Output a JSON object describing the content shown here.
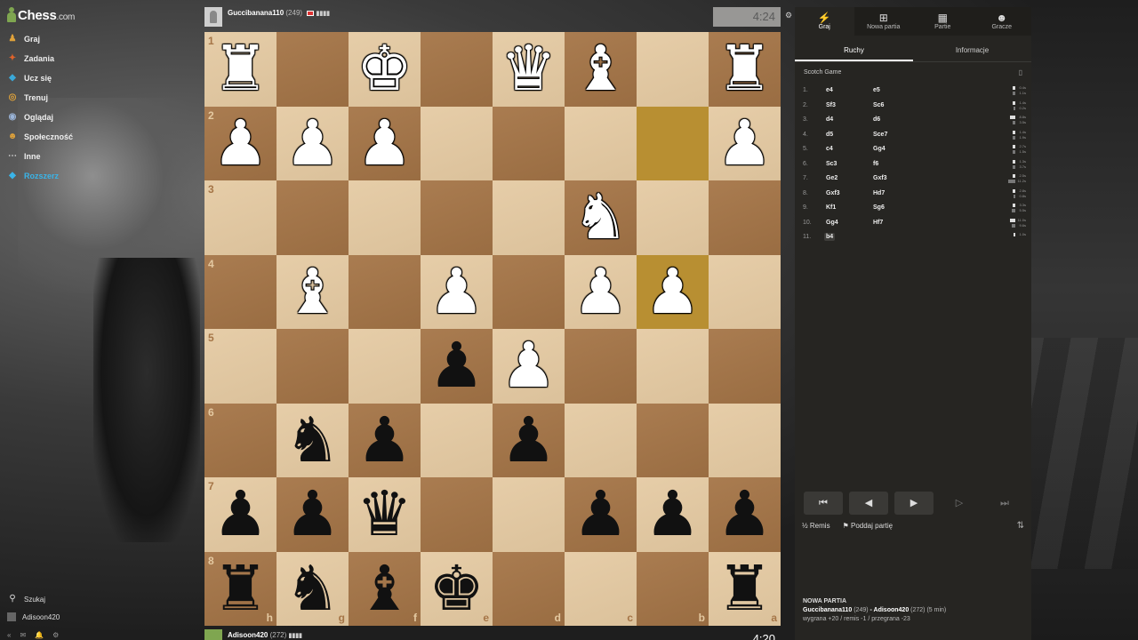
{
  "nav": {
    "brand": "Chess",
    "brand_suffix": ".com",
    "items": [
      {
        "label": "Graj",
        "icon": "play-icon",
        "color": "#e0a23a"
      },
      {
        "label": "Zadania",
        "icon": "puzzle-icon",
        "color": "#e0632a"
      },
      {
        "label": "Ucz się",
        "icon": "learn-icon",
        "color": "#3aa8d8"
      },
      {
        "label": "Trenuj",
        "icon": "train-icon",
        "color": "#e0a23a"
      },
      {
        "label": "Oglądaj",
        "icon": "watch-icon",
        "color": "#9ab4d8"
      },
      {
        "label": "Społeczność",
        "icon": "community-icon",
        "color": "#e0a23a"
      },
      {
        "label": "Inne",
        "icon": "more-icon",
        "color": "#cccccc"
      },
      {
        "label": "Rozszerz",
        "icon": "diamond-icon",
        "color": "#3ab4e8"
      }
    ],
    "search_label": "Szukaj",
    "user_label": "Adisoon420"
  },
  "top_player": {
    "name": "Guccibanana110",
    "rating": "(249)",
    "clock": "4:24"
  },
  "bottom_player": {
    "name": "Adisoon420",
    "rating": "(272)",
    "clock": "4:20"
  },
  "board": {
    "ranks": [
      "1",
      "2",
      "3",
      "4",
      "5",
      "6",
      "7",
      "8"
    ],
    "files": [
      "h",
      "g",
      "f",
      "e",
      "d",
      "c",
      "b",
      "a"
    ],
    "pieces": [
      {
        "row": 0,
        "col": 0,
        "glyph": "♜",
        "color": "white",
        "name": "white-rook"
      },
      {
        "row": 0,
        "col": 2,
        "glyph": "♚",
        "color": "white",
        "name": "white-king"
      },
      {
        "row": 0,
        "col": 4,
        "glyph": "♛",
        "color": "white",
        "name": "white-queen"
      },
      {
        "row": 0,
        "col": 5,
        "glyph": "♝",
        "color": "white",
        "name": "white-bishop"
      },
      {
        "row": 0,
        "col": 7,
        "glyph": "♜",
        "color": "white",
        "name": "white-rook"
      },
      {
        "row": 1,
        "col": 0,
        "glyph": "♟",
        "color": "white",
        "name": "white-pawn"
      },
      {
        "row": 1,
        "col": 1,
        "glyph": "♟",
        "color": "white",
        "name": "white-pawn"
      },
      {
        "row": 1,
        "col": 2,
        "glyph": "♟",
        "color": "white",
        "name": "white-pawn"
      },
      {
        "row": 1,
        "col": 7,
        "glyph": "♟",
        "color": "white",
        "name": "white-pawn"
      },
      {
        "row": 2,
        "col": 5,
        "glyph": "♞",
        "color": "white",
        "name": "white-knight"
      },
      {
        "row": 3,
        "col": 1,
        "glyph": "♝",
        "color": "white",
        "name": "white-bishop"
      },
      {
        "row": 3,
        "col": 3,
        "glyph": "♟",
        "color": "white",
        "name": "white-pawn"
      },
      {
        "row": 3,
        "col": 5,
        "glyph": "♟",
        "color": "white",
        "name": "white-pawn"
      },
      {
        "row": 3,
        "col": 6,
        "glyph": "♟",
        "color": "white",
        "name": "white-pawn"
      },
      {
        "row": 4,
        "col": 3,
        "glyph": "♟",
        "color": "black",
        "name": "black-pawn"
      },
      {
        "row": 4,
        "col": 4,
        "glyph": "♟",
        "color": "white",
        "name": "white-pawn"
      },
      {
        "row": 5,
        "col": 1,
        "glyph": "♞",
        "color": "black",
        "name": "black-knight"
      },
      {
        "row": 5,
        "col": 2,
        "glyph": "♟",
        "color": "black",
        "name": "black-pawn"
      },
      {
        "row": 5,
        "col": 4,
        "glyph": "♟",
        "color": "black",
        "name": "black-pawn"
      },
      {
        "row": 6,
        "col": 0,
        "glyph": "♟",
        "color": "black",
        "name": "black-pawn"
      },
      {
        "row": 6,
        "col": 1,
        "glyph": "♟",
        "color": "black",
        "name": "black-pawn"
      },
      {
        "row": 6,
        "col": 2,
        "glyph": "♛",
        "color": "black",
        "name": "black-queen"
      },
      {
        "row": 6,
        "col": 5,
        "glyph": "♟",
        "color": "black",
        "name": "black-pawn"
      },
      {
        "row": 6,
        "col": 6,
        "glyph": "♟",
        "color": "black",
        "name": "black-pawn"
      },
      {
        "row": 6,
        "col": 7,
        "glyph": "♟",
        "color": "black",
        "name": "black-pawn"
      },
      {
        "row": 7,
        "col": 0,
        "glyph": "♜",
        "color": "black",
        "name": "black-rook"
      },
      {
        "row": 7,
        "col": 1,
        "glyph": "♞",
        "color": "black",
        "name": "black-knight"
      },
      {
        "row": 7,
        "col": 2,
        "glyph": "♝",
        "color": "black",
        "name": "black-bishop"
      },
      {
        "row": 7,
        "col": 3,
        "glyph": "♚",
        "color": "black",
        "name": "black-king"
      },
      {
        "row": 7,
        "col": 7,
        "glyph": "♜",
        "color": "black",
        "name": "black-rook"
      }
    ],
    "highlighted": [
      {
        "row": 1,
        "col": 6
      },
      {
        "row": 3,
        "col": 6
      }
    ]
  },
  "panel": {
    "tabs": [
      {
        "label": "Graj",
        "icon": "bolt-icon",
        "active": true
      },
      {
        "label": "Nowa partia",
        "icon": "plus-icon",
        "active": false
      },
      {
        "label": "Partie",
        "icon": "board-icon",
        "active": false
      },
      {
        "label": "Gracze",
        "icon": "players-icon",
        "active": false
      }
    ],
    "subtabs": [
      {
        "label": "Ruchy",
        "active": true
      },
      {
        "label": "Informacje",
        "active": false
      }
    ],
    "opening": "Scotch Game",
    "moves": [
      {
        "num": "1.",
        "w": "e4",
        "b": "e5",
        "tw": "0.4s",
        "tb": "1.1s",
        "bw": 3,
        "bb": 3
      },
      {
        "num": "2.",
        "w": "Sf3",
        "b": "Sc6",
        "tw": "1.4s",
        "tb": "0.2s",
        "bw": 3,
        "bb": 2
      },
      {
        "num": "3.",
        "w": "d4",
        "b": "d6",
        "tw": "8.8s",
        "tb": "3.5s",
        "bw": 6,
        "bb": 3
      },
      {
        "num": "4.",
        "w": "d5",
        "b": "Sce7",
        "tw": "1.4s",
        "tb": "1.9s",
        "bw": 3,
        "bb": 3
      },
      {
        "num": "5.",
        "w": "c4",
        "b": "Gg4",
        "tw": "2.7s",
        "tb": "1.5s",
        "bw": 3,
        "bb": 3
      },
      {
        "num": "6.",
        "w": "Sc3",
        "b": "f6",
        "tw": "1.3s",
        "tb": "3.7s",
        "bw": 3,
        "bb": 3
      },
      {
        "num": "7.",
        "w": "Ge2",
        "b": "Gxf3",
        "tw": "2.5s",
        "tb": "11.2s",
        "bw": 3,
        "bb": 8
      },
      {
        "num": "8.",
        "w": "Gxf3",
        "b": "Hd7",
        "tw": "2.8s",
        "tb": "0.8s",
        "bw": 3,
        "bb": 2
      },
      {
        "num": "9.",
        "w": "Kf1",
        "b": "Sg6",
        "tw": "3.3s",
        "tb": "5.5s",
        "bw": 3,
        "bb": 4
      },
      {
        "num": "10.",
        "w": "Gg4",
        "b": "Hf7",
        "tw": "11.0s",
        "tb": "9.6s",
        "bw": 6,
        "bb": 4
      },
      {
        "num": "11.",
        "w": "b4",
        "b": "",
        "tw": "1.0s",
        "tb": "",
        "bw": 2,
        "bb": 0
      }
    ],
    "actions": {
      "draw": "Remis",
      "resign": "Poddaj partię"
    },
    "new_game": {
      "title": "NOWA PARTIA",
      "players_a": "Guccibanana110",
      "rating_a": "(249)",
      "players_sep": " - ",
      "players_b": "Adisoon420",
      "rating_b": "(272)",
      "time_control": "(5 min)",
      "result_line": "wygrana +20 / remis -1 / przegrana -23"
    }
  },
  "colors": {
    "light_square": "#e4c9a1",
    "dark_square": "#a57547",
    "highlight": "#c9a84f",
    "panel_bg": "#262522"
  }
}
